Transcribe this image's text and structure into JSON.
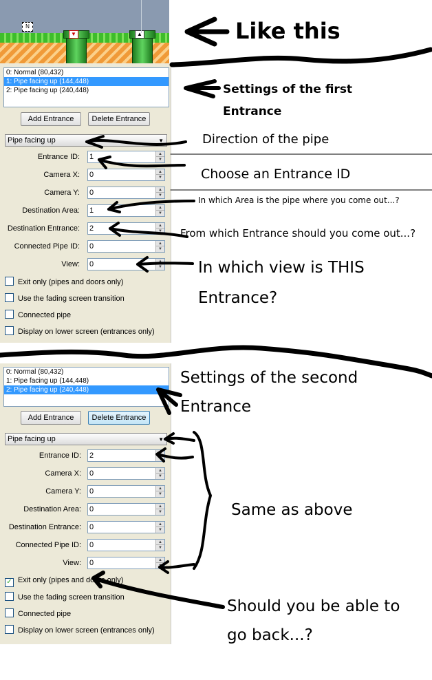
{
  "top_annotation": "Like this",
  "panel1": {
    "list": [
      "0: Normal (80,432)",
      "1: Pipe facing up (144,448)",
      "2: Pipe facing up (240,448)"
    ],
    "selected_index": 1,
    "add_button": "Add Entrance",
    "delete_button": "Delete Entrance",
    "direction": "Pipe facing up",
    "fields": [
      {
        "label": "Entrance ID:",
        "value": "1"
      },
      {
        "label": "Camera X:",
        "value": "0"
      },
      {
        "label": "Camera Y:",
        "value": "0"
      },
      {
        "label": "Destination Area:",
        "value": "1"
      },
      {
        "label": "Destination Entrance:",
        "value": "2"
      },
      {
        "label": "Connected Pipe ID:",
        "value": "0"
      },
      {
        "label": "View:",
        "value": "0"
      }
    ],
    "checkboxes": [
      {
        "label": "Exit only (pipes and doors only)",
        "checked": false
      },
      {
        "label": "Use the fading screen transition",
        "checked": false
      },
      {
        "label": "Connected pipe",
        "checked": false
      },
      {
        "label": "Display on lower screen (entrances only)",
        "checked": false
      }
    ]
  },
  "panel2": {
    "list": [
      "0: Normal (80,432)",
      "1: Pipe facing up (144,448)",
      "2: Pipe facing up (240,448)"
    ],
    "selected_index": 2,
    "add_button": "Add Entrance",
    "delete_button": "Delete Entrance",
    "direction": "Pipe facing up",
    "fields": [
      {
        "label": "Entrance ID:",
        "value": "2"
      },
      {
        "label": "Camera X:",
        "value": "0"
      },
      {
        "label": "Camera Y:",
        "value": "0"
      },
      {
        "label": "Destination Area:",
        "value": "0"
      },
      {
        "label": "Destination Entrance:",
        "value": "0"
      },
      {
        "label": "Connected Pipe ID:",
        "value": "0"
      },
      {
        "label": "View:",
        "value": "0"
      }
    ],
    "checkboxes": [
      {
        "label": "Exit only (pipes and doors only)",
        "checked": true
      },
      {
        "label": "Use the fading screen transition",
        "checked": false
      },
      {
        "label": "Connected pipe",
        "checked": false
      },
      {
        "label": "Display on lower screen (entrances only)",
        "checked": false
      }
    ]
  },
  "annotations": {
    "settings_first_line1": "Settings of the first",
    "settings_first_line2": "Entrance",
    "direction": "Direction of the pipe",
    "entrance_id": "Choose an Entrance ID",
    "dest_area": "In which Area is the pipe where you come out...?",
    "dest_entrance": "From which Entrance should you come out...?",
    "view_line1": "In which view is THIS",
    "view_line2": "Entrance?",
    "settings_second_line1": "Settings of the second",
    "settings_second_line2": "Entrance",
    "same": "Same as above",
    "back_line1": "Should you be able to",
    "back_line2": "go back...?"
  }
}
